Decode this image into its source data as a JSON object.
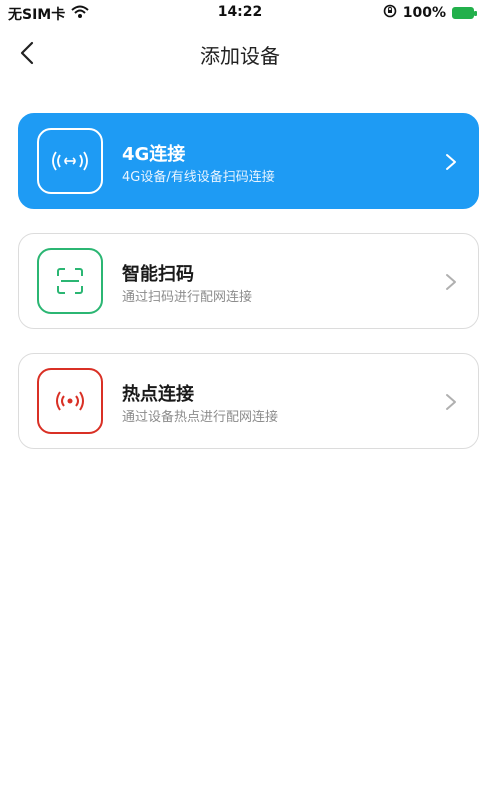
{
  "status": {
    "carrier": "无SIM卡",
    "time": "14:22",
    "battery": "100%"
  },
  "nav": {
    "title": "添加设备"
  },
  "options": [
    {
      "title": "4G连接",
      "subtitle": "4G设备/有线设备扫码连接",
      "icon": "4g-connection-icon",
      "color": "#1e9bf4",
      "active": true
    },
    {
      "title": "智能扫码",
      "subtitle": "通过扫码进行配网连接",
      "icon": "scan-code-icon",
      "color": "#2bb673",
      "active": false
    },
    {
      "title": "热点连接",
      "subtitle": "通过设备热点进行配网连接",
      "icon": "hotspot-icon",
      "color": "#d93025",
      "active": false
    }
  ]
}
